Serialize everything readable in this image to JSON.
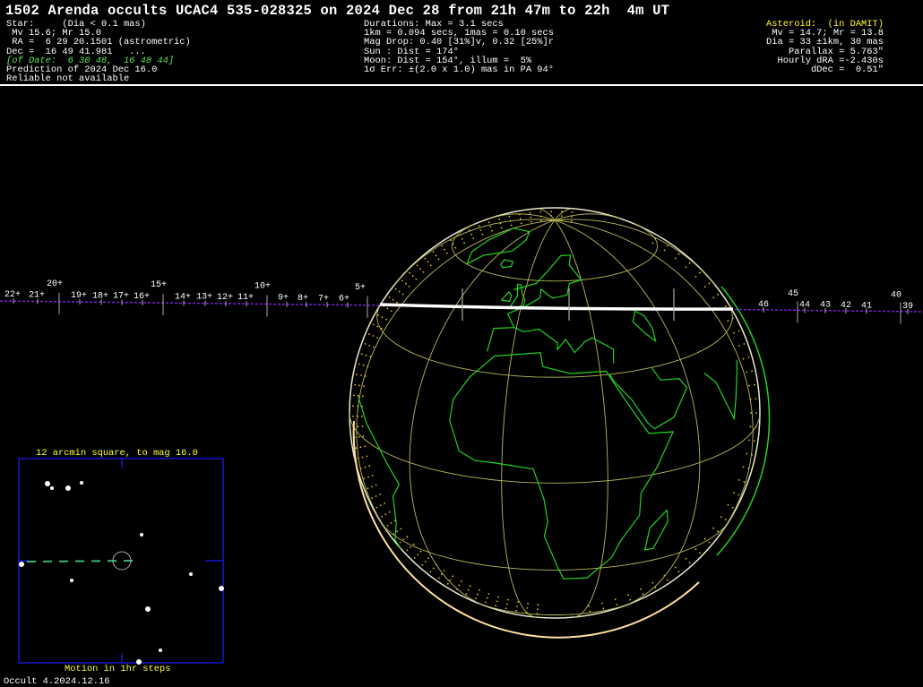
{
  "header": {
    "title": "1502 Arenda occults UCAC4 535-028325 on 2024 Dec 28 from 21h 47m to 22h  4m UT"
  },
  "star_info": [
    {
      "text": "Star:     (Dia < 0.1 mas)",
      "style": "white"
    },
    {
      "text": " Mv 15.6; Mr 15.0",
      "style": "white"
    },
    {
      "text": " RA =  6 29 20.1501 (astrometric)",
      "style": "white"
    },
    {
      "text": "Dec =  16 49 41.981   ...",
      "style": "white"
    },
    {
      "text": "[of Date:  6 30 48,  16 48 44]",
      "style": "green"
    },
    {
      "text": "Prediction of 2024 Dec 16.0",
      "style": "white"
    },
    {
      "text": "Reliable not available",
      "style": "white"
    }
  ],
  "event_info": [
    "Durations: Max = 3.1 secs",
    "1km = 0.094 secs, 1mas = 0.10 secs",
    "Mag Drop: 0.40 [31%]v, 0.32 [25%]r",
    "Sun : Dist = 174°",
    "Moon: Dist = 154°, illum =  5%",
    "1σ Err: ±(2.0 x 1.0) mas in PA 94°"
  ],
  "asteroid_info": [
    {
      "text": "Asteroid:  (in DAMIT)",
      "style": "yellow"
    },
    {
      "text": "Mv = 14.7; Mr = 13.8",
      "style": "white"
    },
    {
      "text": "Dia = 33 ±1km, 30 mas",
      "style": "white"
    },
    {
      "text": "Parallax = 5.763\"",
      "style": "white"
    },
    {
      "text": "Hourly dRA =-2.430s",
      "style": "white"
    },
    {
      "text": "dDec =  0.51\"",
      "style": "white"
    }
  ],
  "track": {
    "color": "#7a1fd6",
    "left_ticks": [
      "22+",
      "21+",
      "20+",
      "19+",
      "18+",
      "17+",
      "16+",
      "15+",
      "14+",
      "13+",
      "12+",
      "11+",
      "10+",
      "9+",
      "8+",
      "7+",
      "6+",
      "5+"
    ],
    "right_ticks": [
      "46",
      "45",
      "44",
      "43",
      "42",
      "41",
      "40",
      "39"
    ]
  },
  "globe": {
    "grid_color": "#b8b85a",
    "coast_color": "#22d322",
    "path_color": "#ffffff"
  },
  "finder": {
    "title": "12 arcmin square, to mag 16.0",
    "caption": "Motion in 1hr steps",
    "frame_color": "#1a1aff"
  },
  "footer": {
    "version": "Occult 4.2024.12.16"
  }
}
